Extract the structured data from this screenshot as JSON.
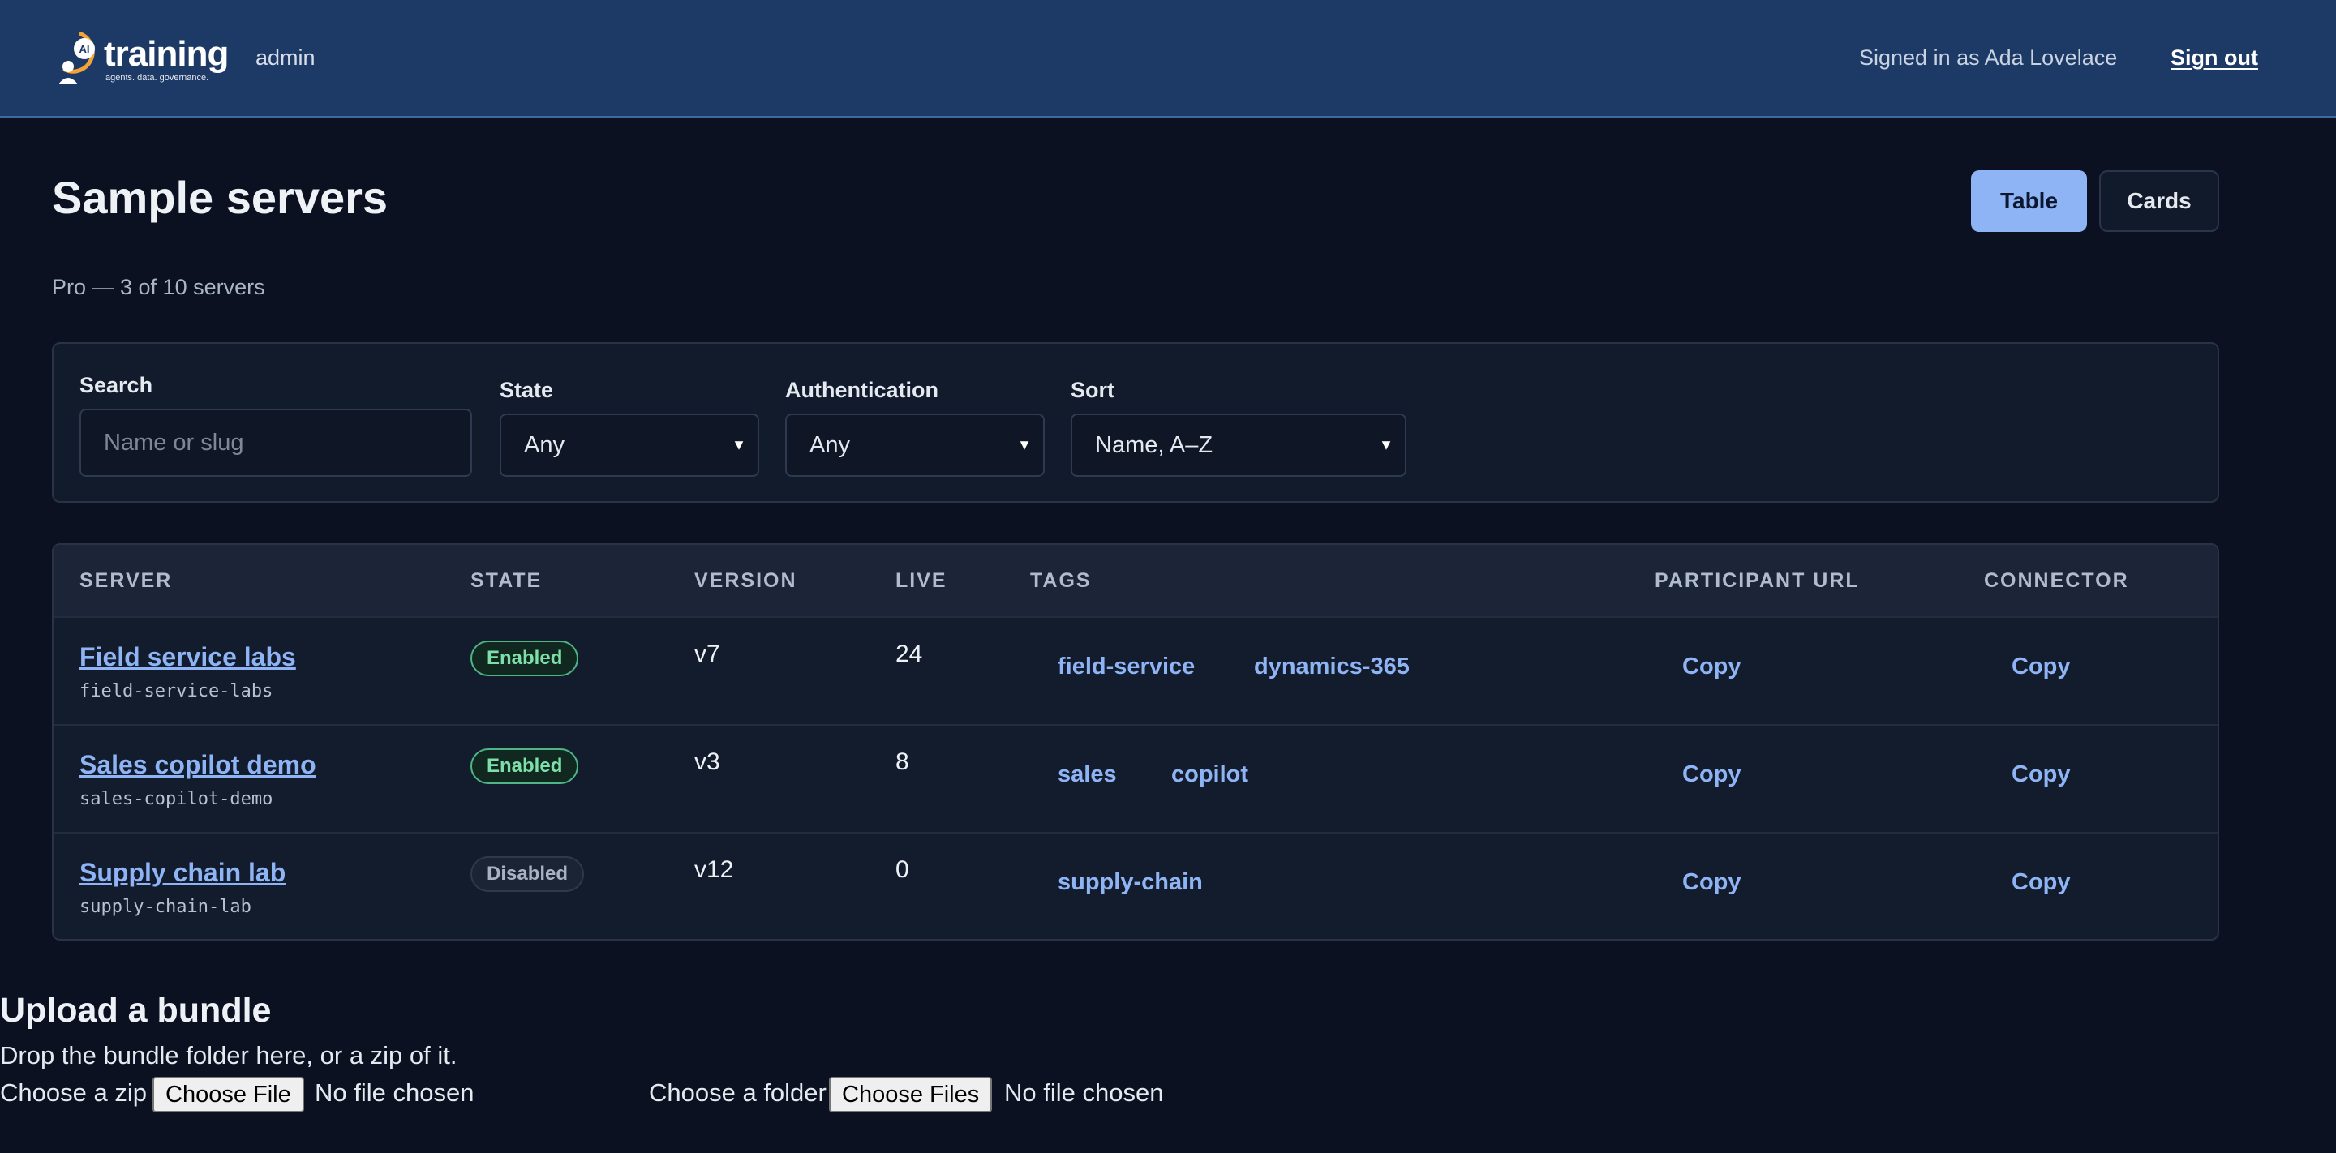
{
  "header": {
    "logo_word": "training",
    "logo_tagline": "agents. data. governance.",
    "role": "admin",
    "signed_in": "Signed in as Ada Lovelace",
    "sign_out": "Sign out"
  },
  "page": {
    "title": "Sample servers",
    "plan": "Pro — 3 of 10 servers",
    "view_table": "Table",
    "view_cards": "Cards"
  },
  "filters": {
    "search_label": "Search",
    "search_placeholder": "Name or slug",
    "state_label": "State",
    "state_value": "Any",
    "auth_label": "Authentication",
    "auth_value": "Any",
    "sort_label": "Sort",
    "sort_value": "Name, A–Z"
  },
  "table": {
    "headers": [
      "SERVER",
      "STATE",
      "VERSION",
      "LIVE",
      "TAGS",
      "PARTICIPANT URL",
      "CONNECTOR"
    ],
    "rows": [
      {
        "name": "Field service labs",
        "slug": "field-service-labs",
        "state": "Enabled",
        "version": "v7",
        "live": "24",
        "tags": [
          "field-service",
          "dynamics-365"
        ],
        "participant": "Copy",
        "connector": "Copy"
      },
      {
        "name": "Sales copilot demo",
        "slug": "sales-copilot-demo",
        "state": "Enabled",
        "version": "v3",
        "live": "8",
        "tags": [
          "sales",
          "copilot"
        ],
        "participant": "Copy",
        "connector": "Copy"
      },
      {
        "name": "Supply chain lab",
        "slug": "supply-chain-lab",
        "state": "Disabled",
        "version": "v12",
        "live": "0",
        "tags": [
          "supply-chain"
        ],
        "participant": "Copy",
        "connector": "Copy"
      }
    ]
  },
  "upload": {
    "title": "Upload a bundle",
    "hint": "Drop the bundle folder here, or a zip of it.",
    "zip_label": "Choose a zip",
    "zip_button": "Choose File",
    "zip_status": "No file chosen",
    "folder_label": "Choose a folder",
    "folder_button": "Choose Files",
    "folder_status": "No file chosen"
  },
  "colors": {
    "header_bg": "#1d3a66",
    "page_bg": "#0b1120",
    "accent": "#8fb4f5",
    "enabled": "#7ee0a8",
    "logo_accent": "#f2a33a"
  }
}
